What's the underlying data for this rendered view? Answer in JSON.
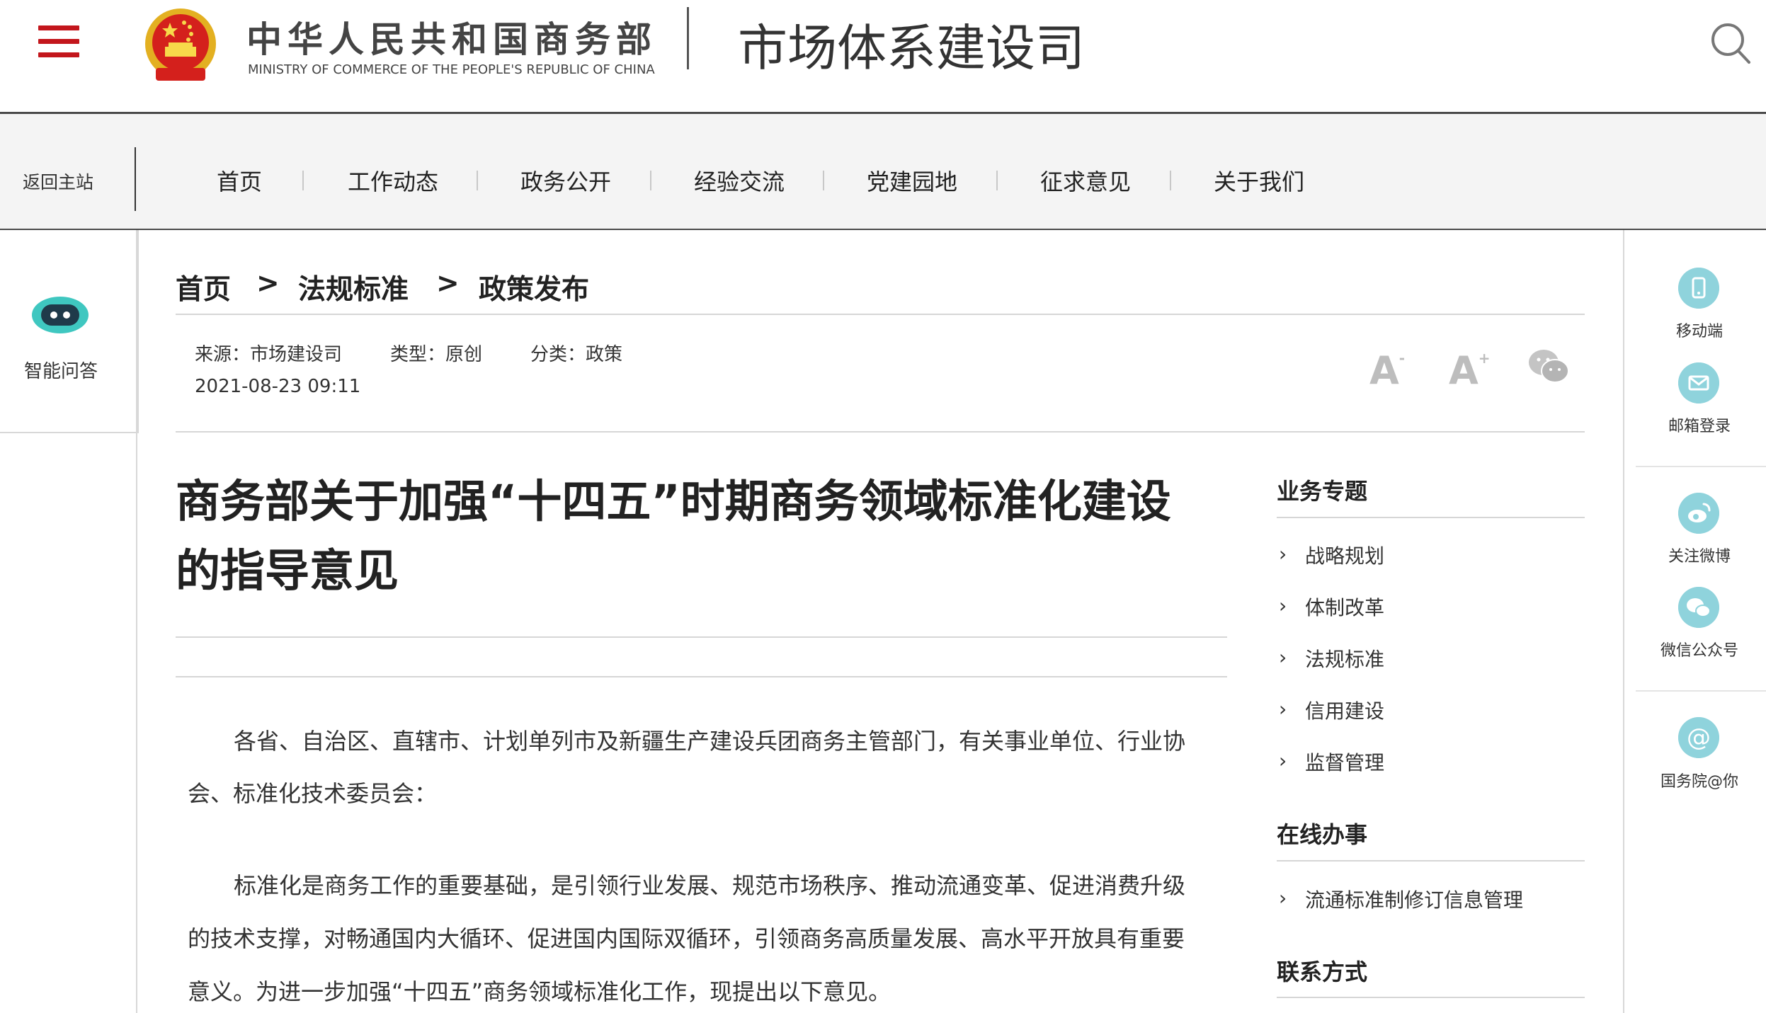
{
  "header": {
    "org_name_cn": "中华人民共和国商务部",
    "org_name_en": "MINISTRY OF COMMERCE OF THE PEOPLE'S REPUBLIC OF CHINA",
    "department": "市场体系建设司"
  },
  "nav": {
    "back_label": "返回主站",
    "items": [
      "首页",
      "工作动态",
      "政务公开",
      "经验交流",
      "党建园地",
      "征求意见",
      "关于我们"
    ]
  },
  "left_sidebar": {
    "assistant_label": "智能问答"
  },
  "breadcrumb": {
    "items": [
      "首页",
      "法规标准",
      "政策发布"
    ],
    "separator": ">"
  },
  "meta": {
    "source": "来源：市场建设司",
    "type": "类型：原创",
    "category": "分类：政策",
    "date": "2021-08-23 09:11"
  },
  "tools": {
    "font_smaller": "A",
    "font_larger": "A",
    "font_sup_minus": "-",
    "font_sup_plus": "+"
  },
  "article": {
    "title_line1": "商务部关于加强“十四五”时期商务领域标准化建设",
    "title_line2": "的指导意见",
    "p1_l1": "各省、自治区、直辖市、计划单列市及新疆生产建设兵团商务主管部门，有关事业单位、行业协",
    "p1_l2": "会、标准化技术委员会：",
    "p2_l1": "标准化是商务工作的重要基础，是引领行业发展、规范市场秩序、推动流通变革、促进消费升级",
    "p2_l2": "的技术支撑，对畅通国内大循环、促进国内国际双循环，引领商务高质量发展、高水平开放具有重要",
    "p2_l3": "意义。为进一步加强“十四五”商务领域标准化工作，现提出以下意见。"
  },
  "sidebar": {
    "topics_heading": "业务专题",
    "topics": [
      "战略规划",
      "体制改革",
      "法规标准",
      "信用建设",
      "监督管理"
    ],
    "online_heading": "在线办事",
    "online": [
      "流通标准制修订信息管理"
    ],
    "contact_heading": "联系方式"
  },
  "right_bar": {
    "items": [
      "移动端",
      "邮箱登录",
      "关注微博",
      "微信公众号",
      "国务院@你"
    ]
  },
  "colors": {
    "accent_red": "#c3161c",
    "icon_teal": "#8fd3dc",
    "emblem_gold": "#e3b021"
  }
}
